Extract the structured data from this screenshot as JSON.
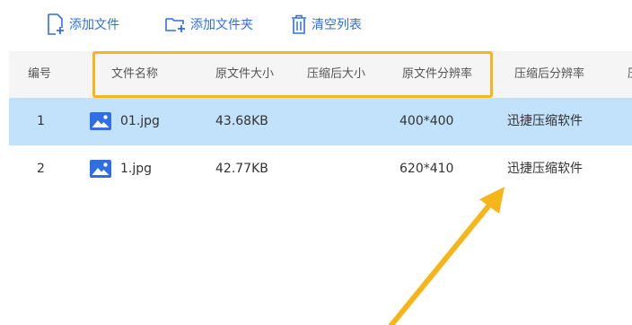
{
  "toolbar": {
    "add_file_label": "添加文件",
    "add_folder_label": "添加文件夹",
    "clear_list_label": "清空列表"
  },
  "table": {
    "columns": [
      "编号",
      "文件名称",
      "原文件大小",
      "压缩后大小",
      "原文件分辨率",
      "压缩后分辨率",
      "压"
    ],
    "rows": [
      {
        "index": "1",
        "name": "01.jpg",
        "original_size": "43.68KB",
        "compressed_size": "",
        "original_resolution": "400*400",
        "compressed_resolution": "迅捷压缩软件",
        "selected": true
      },
      {
        "index": "2",
        "name": "1.jpg",
        "original_size": "42.77KB",
        "compressed_size": "",
        "original_resolution": "620*410",
        "compressed_resolution": "迅捷压缩软件",
        "selected": false
      }
    ]
  },
  "colors": {
    "accent": "#2f6fe4",
    "selected_row": "#c2e1fb",
    "header_bg": "#f5f5f5",
    "highlight": "#f6b619",
    "arrow": "#f6b619"
  },
  "icons": {
    "add_file": "file-plus-icon",
    "add_folder": "folder-plus-icon",
    "clear_list": "trash-icon",
    "file_type": "image-file-icon"
  }
}
